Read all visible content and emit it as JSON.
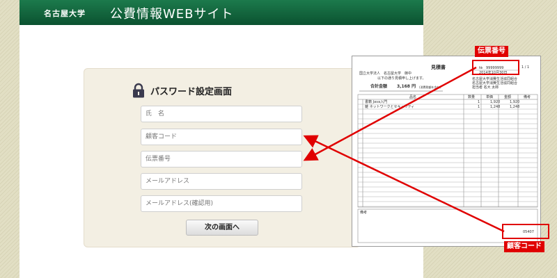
{
  "header": {
    "university": "名古屋大学",
    "site_title": "公費情報WEBサイト"
  },
  "form": {
    "title": "パスワード設定画面",
    "fields": [
      {
        "placeholder": "氏　名"
      },
      {
        "placeholder": "顧客コード"
      },
      {
        "placeholder": "伝票番号"
      },
      {
        "placeholder": "メールアドレス"
      },
      {
        "placeholder": "メールアドレス(確認用)"
      }
    ],
    "next_button": "次の画面へ"
  },
  "document": {
    "title": "見積書",
    "page": "1 / 1",
    "no_label": "№",
    "no_value": "99999999",
    "date": "2014年10月30日",
    "recipient": "国立大学法人　名古屋大学　御中",
    "greeting": "以下の通り見積申し上げます。",
    "total_label": "合計金額",
    "total_value": "3,168 円",
    "total_note": "(消費税額を含む)",
    "supplier_1": "名古屋大学消費生活協同組合",
    "supplier_2": "名古屋大学消費生活協同組合",
    "supplier_3": "担当者  名大 太郎",
    "col_item": "品名",
    "col_qty": "数量",
    "col_price": "単価",
    "col_amount": "金額",
    "col_note": "備考",
    "row1_item": "書籍  Java入門",
    "row1_qty": "1",
    "row1_price": "1,920",
    "row1_amount": "1,920",
    "row2_item": "雑  ネットワークとセキュリティ",
    "row2_qty": "1",
    "row2_price": "1,248",
    "row2_amount": "1,248",
    "remarks_label": "備考",
    "customer_code": "05407"
  },
  "annotations": {
    "slip_number_label": "伝票番号",
    "customer_code_label": "顧客コード"
  },
  "colors": {
    "header_green": "#0b5230",
    "annotation_red": "#e00000"
  }
}
